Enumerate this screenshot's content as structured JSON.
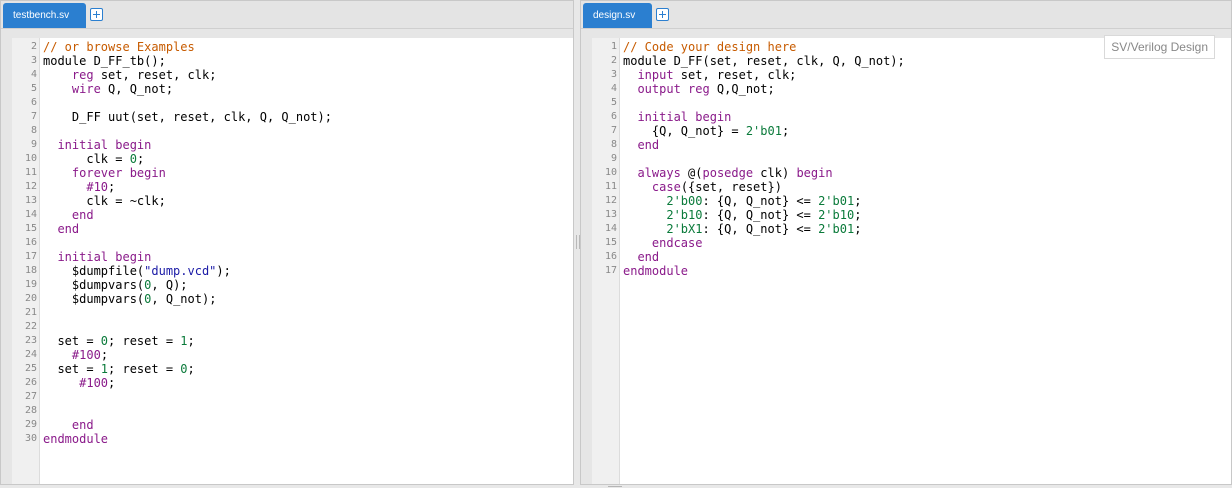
{
  "left": {
    "tab_label": "testbench.sv",
    "lines": [
      {
        "n": "2",
        "code": [
          {
            "t": "// or browse Examples",
            "c": "cm"
          }
        ]
      },
      {
        "n": "3",
        "code": [
          {
            "t": "module D_FF_tb();",
            "c": ""
          }
        ]
      },
      {
        "n": "4",
        "code": [
          {
            "t": "    ",
            "c": ""
          },
          {
            "t": "reg",
            "c": "kw"
          },
          {
            "t": " set, reset, clk;",
            "c": ""
          }
        ]
      },
      {
        "n": "5",
        "code": [
          {
            "t": "    ",
            "c": ""
          },
          {
            "t": "wire",
            "c": "kw"
          },
          {
            "t": " Q, Q_not;",
            "c": ""
          }
        ]
      },
      {
        "n": "6",
        "code": []
      },
      {
        "n": "7",
        "code": [
          {
            "t": "    D_FF uut(set, reset, clk, Q, Q_not);",
            "c": ""
          }
        ]
      },
      {
        "n": "8",
        "code": []
      },
      {
        "n": "9",
        "code": [
          {
            "t": "  ",
            "c": ""
          },
          {
            "t": "initial begin",
            "c": "kw"
          }
        ]
      },
      {
        "n": "10",
        "code": [
          {
            "t": "      clk = ",
            "c": ""
          },
          {
            "t": "0",
            "c": "nm"
          },
          {
            "t": ";",
            "c": ""
          }
        ]
      },
      {
        "n": "11",
        "code": [
          {
            "t": "    ",
            "c": ""
          },
          {
            "t": "forever begin",
            "c": "kw"
          }
        ]
      },
      {
        "n": "12",
        "code": [
          {
            "t": "      ",
            "c": ""
          },
          {
            "t": "#10",
            "c": "kw"
          },
          {
            "t": ";",
            "c": ""
          }
        ]
      },
      {
        "n": "13",
        "code": [
          {
            "t": "      clk = ~clk;",
            "c": ""
          }
        ]
      },
      {
        "n": "14",
        "code": [
          {
            "t": "    ",
            "c": ""
          },
          {
            "t": "end",
            "c": "kw"
          }
        ]
      },
      {
        "n": "15",
        "code": [
          {
            "t": "  ",
            "c": ""
          },
          {
            "t": "end",
            "c": "kw"
          }
        ]
      },
      {
        "n": "16",
        "code": []
      },
      {
        "n": "17",
        "code": [
          {
            "t": "  ",
            "c": ""
          },
          {
            "t": "initial begin",
            "c": "kw"
          }
        ]
      },
      {
        "n": "18",
        "code": [
          {
            "t": "    $dumpfile(",
            "c": ""
          },
          {
            "t": "\"dump.vcd\"",
            "c": "st"
          },
          {
            "t": ");",
            "c": ""
          }
        ]
      },
      {
        "n": "19",
        "code": [
          {
            "t": "    $dumpvars(",
            "c": ""
          },
          {
            "t": "0",
            "c": "nm"
          },
          {
            "t": ", Q);",
            "c": ""
          }
        ]
      },
      {
        "n": "20",
        "code": [
          {
            "t": "    $dumpvars(",
            "c": ""
          },
          {
            "t": "0",
            "c": "nm"
          },
          {
            "t": ", Q_not);",
            "c": ""
          }
        ]
      },
      {
        "n": "21",
        "code": []
      },
      {
        "n": "22",
        "code": []
      },
      {
        "n": "23",
        "code": [
          {
            "t": "  set = ",
            "c": ""
          },
          {
            "t": "0",
            "c": "nm"
          },
          {
            "t": "; reset = ",
            "c": ""
          },
          {
            "t": "1",
            "c": "nm"
          },
          {
            "t": ";",
            "c": ""
          }
        ]
      },
      {
        "n": "24",
        "code": [
          {
            "t": "    ",
            "c": ""
          },
          {
            "t": "#100",
            "c": "kw"
          },
          {
            "t": ";",
            "c": ""
          }
        ]
      },
      {
        "n": "25",
        "code": [
          {
            "t": "  set = ",
            "c": ""
          },
          {
            "t": "1",
            "c": "nm"
          },
          {
            "t": "; reset = ",
            "c": ""
          },
          {
            "t": "0",
            "c": "nm"
          },
          {
            "t": ";",
            "c": ""
          }
        ]
      },
      {
        "n": "26",
        "code": [
          {
            "t": "     ",
            "c": ""
          },
          {
            "t": "#100",
            "c": "kw"
          },
          {
            "t": ";",
            "c": ""
          }
        ]
      },
      {
        "n": "27",
        "code": []
      },
      {
        "n": "28",
        "code": []
      },
      {
        "n": "29",
        "code": [
          {
            "t": "    ",
            "c": ""
          },
          {
            "t": "end",
            "c": "kw"
          }
        ]
      },
      {
        "n": "30",
        "code": [
          {
            "t": "endmodule",
            "c": "kw"
          }
        ]
      }
    ]
  },
  "right": {
    "tab_label": "design.sv",
    "language_badge": "SV/Verilog Design",
    "lines": [
      {
        "n": "1",
        "code": [
          {
            "t": "// Code your design here",
            "c": "cm"
          }
        ]
      },
      {
        "n": "2",
        "code": [
          {
            "t": "module D_FF(set, reset, clk, Q, Q_not);",
            "c": ""
          }
        ]
      },
      {
        "n": "3",
        "code": [
          {
            "t": "  ",
            "c": ""
          },
          {
            "t": "input",
            "c": "kw"
          },
          {
            "t": " set, reset, clk;",
            "c": ""
          }
        ]
      },
      {
        "n": "4",
        "code": [
          {
            "t": "  ",
            "c": ""
          },
          {
            "t": "output reg",
            "c": "kw"
          },
          {
            "t": " Q,Q_not;",
            "c": ""
          }
        ]
      },
      {
        "n": "5",
        "code": []
      },
      {
        "n": "6",
        "code": [
          {
            "t": "  ",
            "c": ""
          },
          {
            "t": "initial begin",
            "c": "kw"
          }
        ]
      },
      {
        "n": "7",
        "code": [
          {
            "t": "    {Q, Q_not} = ",
            "c": ""
          },
          {
            "t": "2'b01",
            "c": "nm"
          },
          {
            "t": ";",
            "c": ""
          }
        ]
      },
      {
        "n": "8",
        "code": [
          {
            "t": "  ",
            "c": ""
          },
          {
            "t": "end",
            "c": "kw"
          }
        ]
      },
      {
        "n": "9",
        "code": []
      },
      {
        "n": "10",
        "code": [
          {
            "t": "  ",
            "c": ""
          },
          {
            "t": "always",
            "c": "kw"
          },
          {
            "t": " @(",
            "c": ""
          },
          {
            "t": "posedge",
            "c": "kw"
          },
          {
            "t": " clk) ",
            "c": ""
          },
          {
            "t": "begin",
            "c": "kw"
          }
        ]
      },
      {
        "n": "11",
        "code": [
          {
            "t": "    ",
            "c": ""
          },
          {
            "t": "case",
            "c": "kw"
          },
          {
            "t": "({set, reset})",
            "c": ""
          }
        ]
      },
      {
        "n": "12",
        "code": [
          {
            "t": "      ",
            "c": ""
          },
          {
            "t": "2'b00",
            "c": "nm"
          },
          {
            "t": ": {Q, Q_not} <= ",
            "c": ""
          },
          {
            "t": "2'b01",
            "c": "nm"
          },
          {
            "t": ";",
            "c": ""
          }
        ]
      },
      {
        "n": "13",
        "code": [
          {
            "t": "      ",
            "c": ""
          },
          {
            "t": "2'b10",
            "c": "nm"
          },
          {
            "t": ": {Q, Q_not} <= ",
            "c": ""
          },
          {
            "t": "2'b10",
            "c": "nm"
          },
          {
            "t": ";",
            "c": ""
          }
        ]
      },
      {
        "n": "14",
        "code": [
          {
            "t": "      ",
            "c": ""
          },
          {
            "t": "2'bX1",
            "c": "nm"
          },
          {
            "t": ": {Q, Q_not} <= ",
            "c": ""
          },
          {
            "t": "2'b01",
            "c": "nm"
          },
          {
            "t": ";",
            "c": ""
          }
        ]
      },
      {
        "n": "15",
        "code": [
          {
            "t": "    ",
            "c": ""
          },
          {
            "t": "endcase",
            "c": "kw"
          }
        ]
      },
      {
        "n": "16",
        "code": [
          {
            "t": "  ",
            "c": ""
          },
          {
            "t": "end",
            "c": "kw"
          }
        ]
      },
      {
        "n": "17",
        "code": [
          {
            "t": "endmodule",
            "c": "kw"
          }
        ]
      }
    ]
  }
}
